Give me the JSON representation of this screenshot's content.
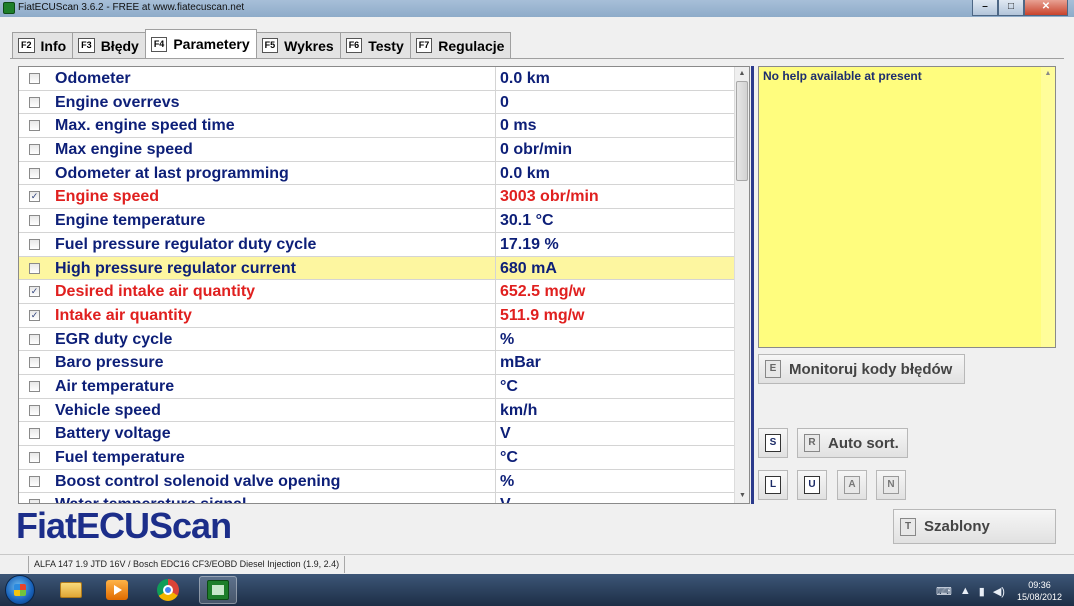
{
  "window": {
    "title": "FiatECUScan 3.6.2 - FREE at www.fiatecuscan.net",
    "controls": {
      "minimize": "–",
      "maximize": "□",
      "close": "✕"
    }
  },
  "tabs": [
    {
      "key": "F2",
      "label": "Info",
      "active": false
    },
    {
      "key": "F3",
      "label": "Błędy",
      "active": false
    },
    {
      "key": "F4",
      "label": "Parametery",
      "active": true
    },
    {
      "key": "F5",
      "label": "Wykres",
      "active": false
    },
    {
      "key": "F6",
      "label": "Testy",
      "active": false
    },
    {
      "key": "F7",
      "label": "Regulacje",
      "active": false
    }
  ],
  "parameters": [
    {
      "name": "Odometer",
      "value": "0.0 km",
      "checked": false,
      "selected": false,
      "highlight": false
    },
    {
      "name": "Engine overrevs",
      "value": "0",
      "checked": false,
      "selected": false,
      "highlight": false
    },
    {
      "name": "Max. engine speed time",
      "value": "0 ms",
      "checked": false,
      "selected": false,
      "highlight": false
    },
    {
      "name": "Max engine speed",
      "value": "0 obr/min",
      "checked": false,
      "selected": false,
      "highlight": false
    },
    {
      "name": "Odometer at last programming",
      "value": "0.0 km",
      "checked": false,
      "selected": false,
      "highlight": false
    },
    {
      "name": "Engine speed",
      "value": "3003 obr/min",
      "checked": true,
      "selected": true,
      "highlight": false
    },
    {
      "name": "Engine temperature",
      "value": "30.1 °C",
      "checked": false,
      "selected": false,
      "highlight": false
    },
    {
      "name": "Fuel pressure regulator duty cycle",
      "value": "17.19 %",
      "checked": false,
      "selected": false,
      "highlight": false
    },
    {
      "name": "High pressure regulator current",
      "value": "680 mA",
      "checked": false,
      "selected": false,
      "highlight": true
    },
    {
      "name": "Desired intake air quantity",
      "value": "652.5 mg/w",
      "checked": true,
      "selected": true,
      "highlight": false
    },
    {
      "name": "Intake air quantity",
      "value": "511.9 mg/w",
      "checked": true,
      "selected": true,
      "highlight": false
    },
    {
      "name": "EGR duty cycle",
      "value": " %",
      "checked": false,
      "selected": false,
      "highlight": false
    },
    {
      "name": "Baro pressure",
      "value": " mBar",
      "checked": false,
      "selected": false,
      "highlight": false
    },
    {
      "name": "Air temperature",
      "value": " °C",
      "checked": false,
      "selected": false,
      "highlight": false
    },
    {
      "name": "Vehicle speed",
      "value": " km/h",
      "checked": false,
      "selected": false,
      "highlight": false
    },
    {
      "name": "Battery voltage",
      "value": " V",
      "checked": false,
      "selected": false,
      "highlight": false
    },
    {
      "name": "Fuel temperature",
      "value": " °C",
      "checked": false,
      "selected": false,
      "highlight": false
    },
    {
      "name": "Boost control solenoid valve opening",
      "value": " %",
      "checked": false,
      "selected": false,
      "highlight": false
    },
    {
      "name": "Water temperature signal",
      "value": " V",
      "checked": false,
      "selected": false,
      "highlight": false
    }
  ],
  "help": {
    "text": "No help available at present"
  },
  "buttons": {
    "monitor": {
      "key": "E",
      "label": "Monitoruj kody błędów"
    },
    "s": {
      "key": "S"
    },
    "auto_sort": {
      "key": "R",
      "label": "Auto sort."
    },
    "l": {
      "key": "L"
    },
    "u": {
      "key": "U"
    },
    "a": {
      "key": "A"
    },
    "n": {
      "key": "N"
    },
    "templates": {
      "key": "T",
      "label": "Szablony"
    }
  },
  "logo": "FiatECUScan",
  "status": {
    "vehicle": "ALFA 147 1.9 JTD 16V / Bosch EDC16 CF3/EOBD Diesel Injection (1.9, 2.4)"
  },
  "taskbar": {
    "time": "09:36",
    "date": "15/08/2012",
    "icons": [
      "start-orb-icon",
      "folder-icon",
      "media-player-icon",
      "chrome-icon",
      "fiatecuscan-icon"
    ]
  },
  "colors": {
    "param_text": "#0d1f78",
    "selected_text": "#e0201f",
    "highlight_row": "#fdf6a0",
    "help_bg": "#fffd7e",
    "divider": "#2b3a8c"
  }
}
